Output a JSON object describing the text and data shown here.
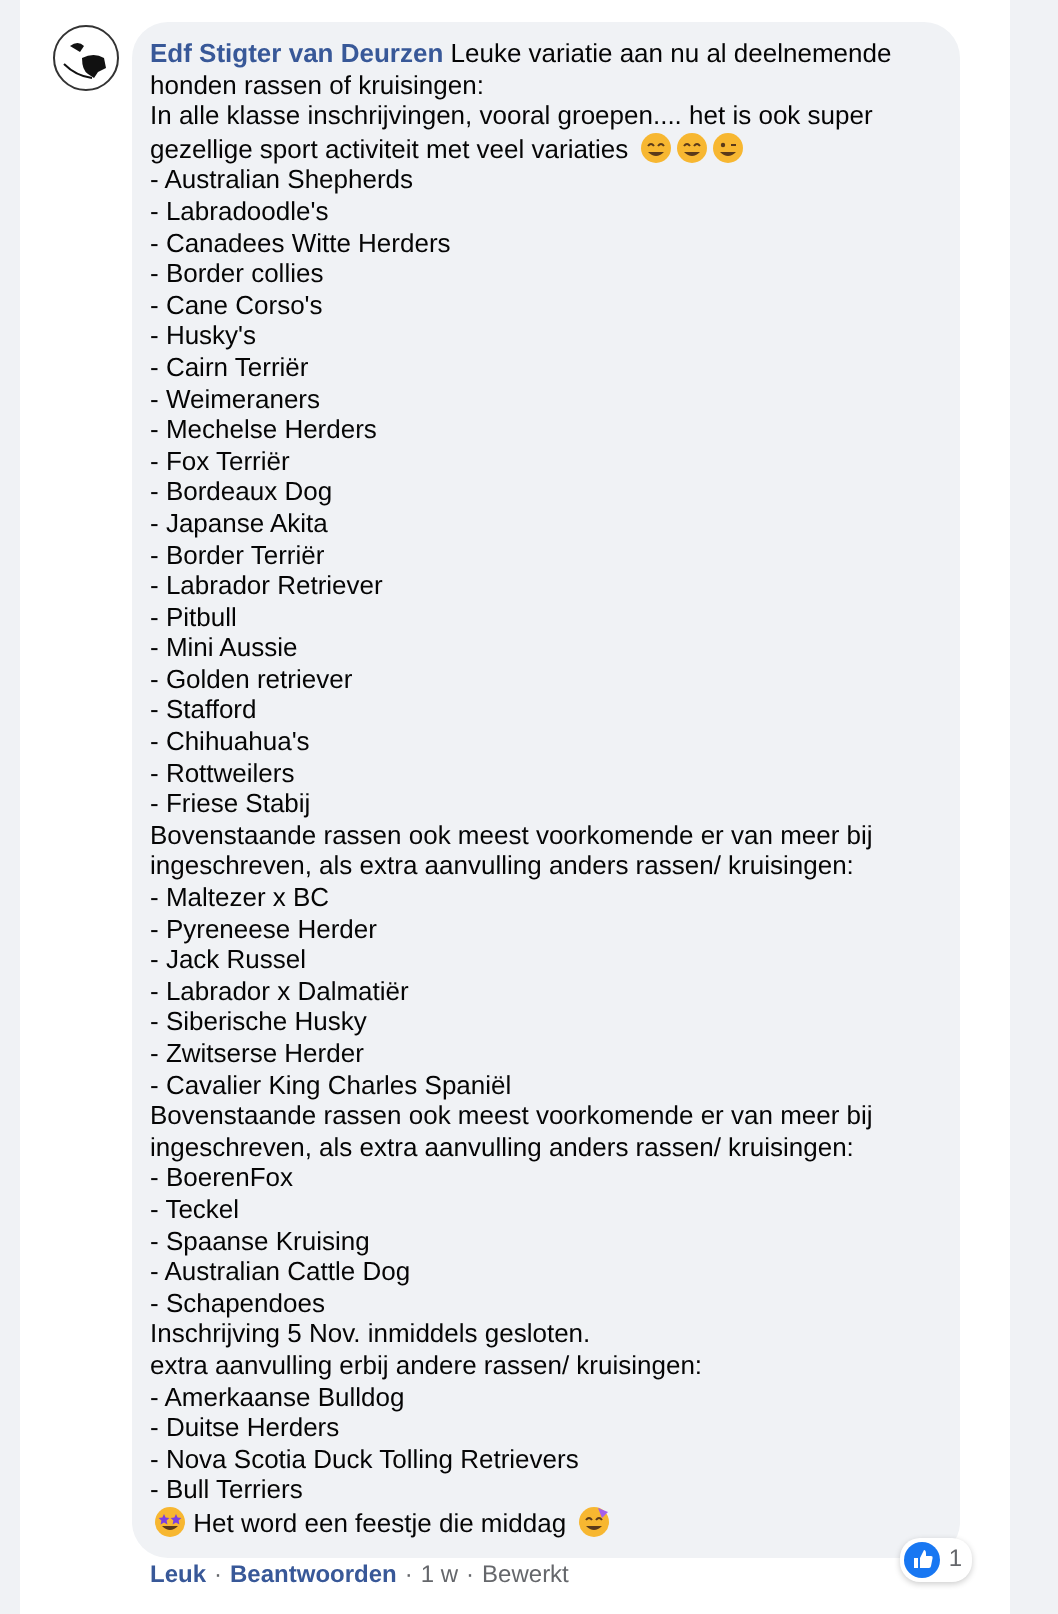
{
  "comment": {
    "author": "Edf Stigter van Deurzen",
    "intro": "Leuke variatie aan nu al deelnemende honden rassen of kruisingen:",
    "intro_2": "In alle klasse inschrijvingen, vooral groepen.... het is ook super gezellige sport activiteit met veel variaties",
    "lines": [
      "- Australian Shepherds",
      "- Labradoodle's",
      "- Canadees Witte Herders",
      "- Border collies",
      "- Cane Corso's",
      "- Husky's",
      "- Cairn Terriër",
      "- Weimeraners",
      "- Mechelse Herders",
      "- Fox Terriër",
      "- Bordeaux Dog",
      "- Japanse Akita",
      "- Border Terriër",
      "- Labrador Retriever",
      "- Pitbull",
      "- Mini Aussie",
      "- Golden retriever",
      "- Stafford",
      "- Chihuahua's",
      "- Rottweilers",
      "- Friese Stabij",
      "Bovenstaande rassen ook meest voorkomende er van meer bij ingeschreven, als extra aanvulling anders rassen/ kruisingen:",
      "- Maltezer x BC",
      "- Pyreneese Herder",
      "- Jack Russel",
      "- Labrador x Dalmatiër",
      "- Siberische Husky",
      "- Zwitserse Herder",
      "- Cavalier King Charles Spaniël",
      "Bovenstaande rassen ook meest voorkomende er van meer bij ingeschreven, als extra aanvulling anders rassen/ kruisingen:",
      "- BoerenFox",
      "- Teckel",
      "- Spaanse Kruising",
      "- Australian Cattle Dog",
      "- Schapendoes",
      "Inschrijving 5 Nov. inmiddels gesloten.",
      "extra aanvulling erbij andere rassen/ kruisingen:",
      "- Amerkaanse Bulldog",
      "- Duitse Herders",
      "- Nova Scotia Duck Tolling Retrievers",
      "- Bull Terriers"
    ],
    "closing": "Het word een feestje die middag",
    "reactions": {
      "count": "1"
    },
    "actions": [
      "Leuk",
      "Beantwoorden",
      "1 w",
      "Bewerkt"
    ],
    "separator": "·"
  }
}
